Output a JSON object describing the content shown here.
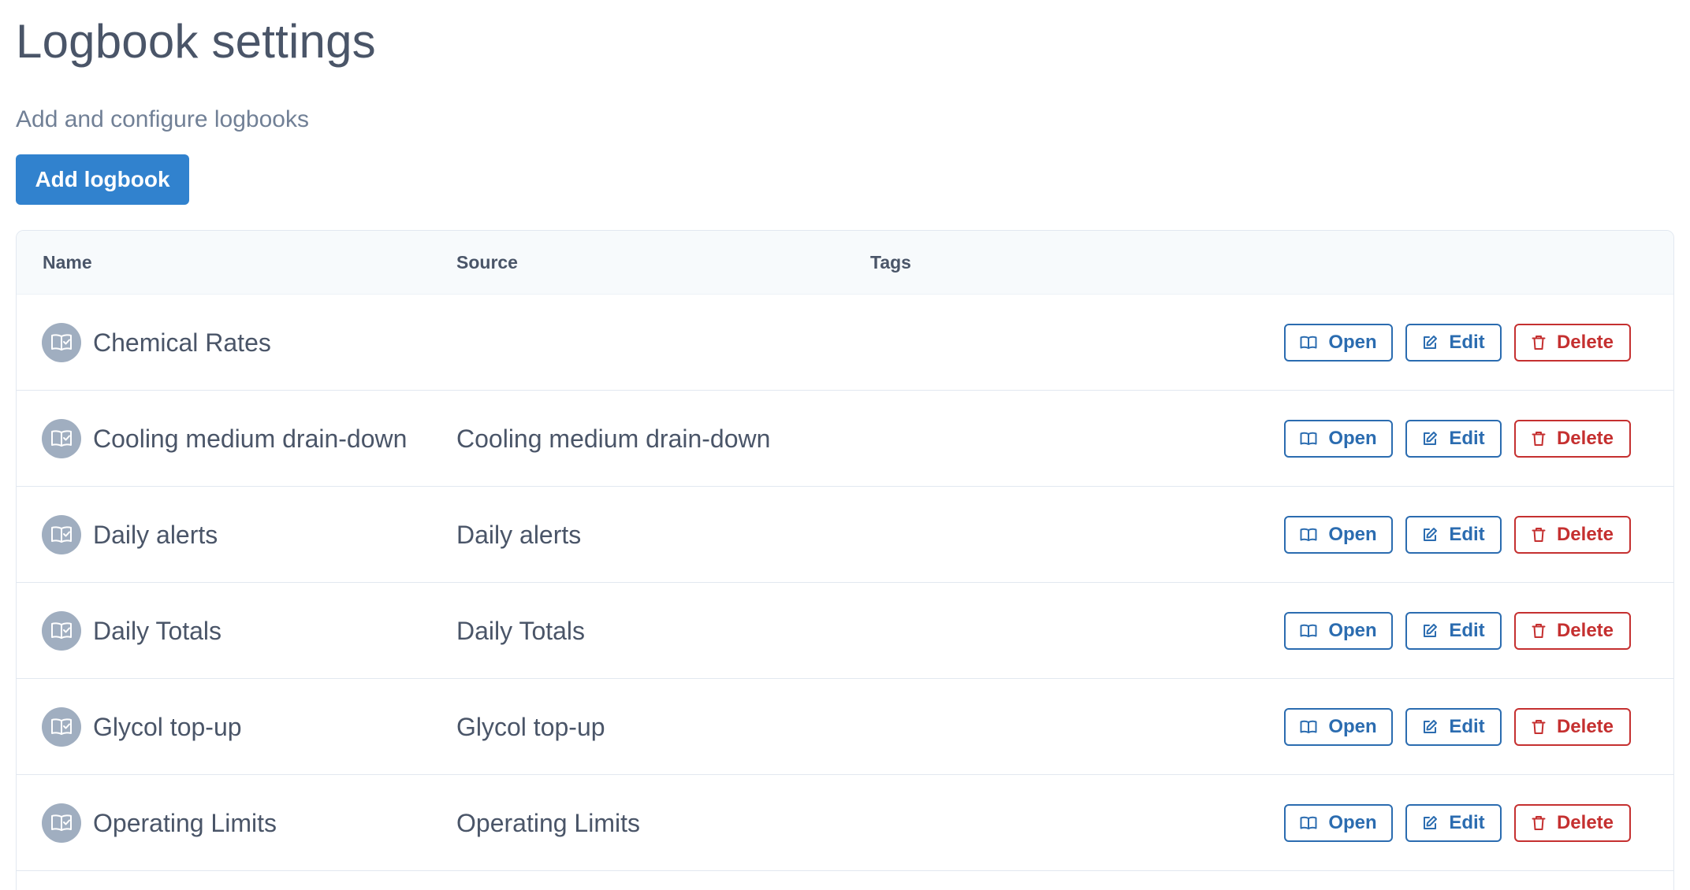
{
  "page": {
    "title": "Logbook settings",
    "subtitle": "Add and configure logbooks",
    "add_button_label": "Add logbook"
  },
  "table": {
    "columns": [
      "Name",
      "Source",
      "Tags"
    ],
    "rows": [
      {
        "name": "Chemical Rates",
        "source": "",
        "tags": "",
        "icon": "logbook-icon"
      },
      {
        "name": "Cooling medium drain-down",
        "source": "Cooling medium drain-down",
        "tags": "",
        "icon": "logbook-icon"
      },
      {
        "name": "Daily alerts",
        "source": "Daily alerts",
        "tags": "",
        "icon": "logbook-icon"
      },
      {
        "name": "Daily Totals",
        "source": "Daily Totals",
        "tags": "",
        "icon": "logbook-icon"
      },
      {
        "name": "Glycol top-up",
        "source": "Glycol top-up",
        "tags": "",
        "icon": "logbook-icon"
      },
      {
        "name": "Operating Limits",
        "source": "Operating Limits",
        "tags": "",
        "icon": "logbook-icon"
      }
    ],
    "row_actions": {
      "open_label": "Open",
      "edit_label": "Edit",
      "delete_label": "Delete",
      "open_icon": "book-open-icon",
      "edit_icon": "pencil-square-icon",
      "delete_icon": "trash-icon"
    }
  },
  "colors": {
    "primary": "#3182ce",
    "action_blue": "#2b6cb0",
    "danger": "#c53030",
    "icon_bg": "#a0aec0",
    "header_bg": "#f7fafc"
  }
}
